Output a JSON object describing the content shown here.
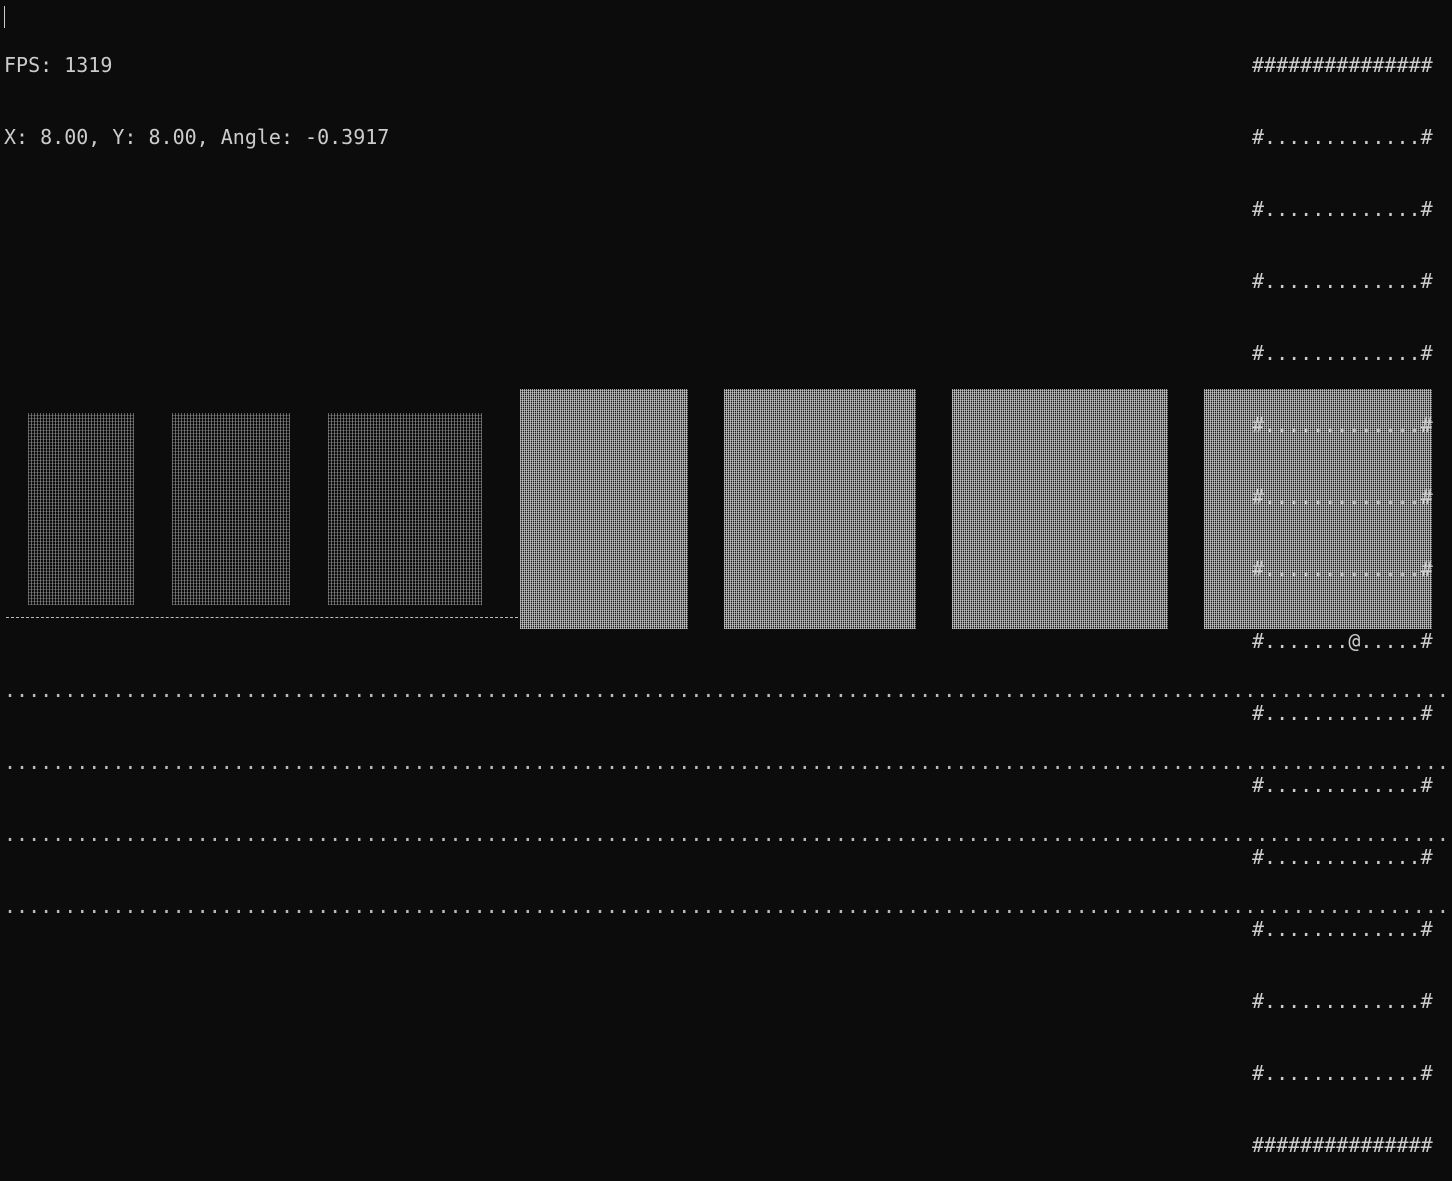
{
  "hud": {
    "fps_text": "FPS: 1319",
    "position_text": "X: 8.00, Y: 8.00, Angle: -0.3917"
  },
  "player": {
    "x": 8.0,
    "y": 8.0,
    "angle": -0.3917,
    "symbol": "@"
  },
  "minimap": {
    "rows": [
      "###############",
      "#.............#",
      "#.............#",
      "#.............#",
      "#.............#",
      "#.............#",
      "#.............#",
      "#.............#",
      "#.......@.....#",
      "#.............#",
      "#.............#",
      "#.............#",
      "#.............#",
      "#.............#",
      "#.............#",
      "###############"
    ]
  },
  "floor": {
    "rows": [
      "............................................................................................................................",
      "............................................................................................................................",
      "............................................................................................................................",
      "............................................................................................................................"
    ]
  },
  "colors": {
    "background": "#0c0c0c",
    "text": "#cccccc"
  }
}
